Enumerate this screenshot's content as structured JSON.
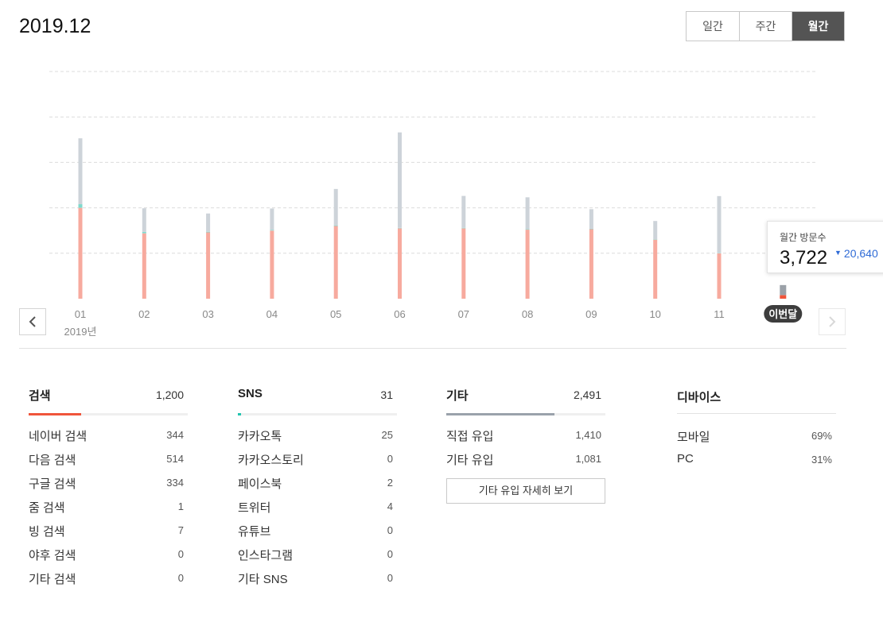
{
  "header": {
    "period": "2019.12"
  },
  "period_tabs": [
    {
      "label": "일간",
      "active": false
    },
    {
      "label": "주간",
      "active": false
    },
    {
      "label": "월간",
      "active": true
    }
  ],
  "chart_data": {
    "type": "bar",
    "stacked": true,
    "categories": [
      "01",
      "02",
      "03",
      "04",
      "05",
      "06",
      "07",
      "08",
      "09",
      "10",
      "11",
      "이번달"
    ],
    "year_label": "2019년",
    "series": [
      {
        "color": "#f7aa9e",
        "values": [
          20000,
          14400,
          14600,
          15000,
          16000,
          15500,
          15500,
          15200,
          15300,
          13000,
          10000,
          780
        ]
      },
      {
        "color": "#7fd9cc",
        "values": [
          800,
          300,
          150,
          150,
          150,
          100,
          120,
          120,
          100,
          100,
          80,
          20
        ]
      },
      {
        "color": "#cdd3d9",
        "values": [
          14500,
          5200,
          4000,
          4700,
          8000,
          21000,
          7000,
          7000,
          4300,
          4000,
          12500,
          2200
        ]
      }
    ],
    "current_colors": [
      "#f0553b",
      "#b8b8b8",
      "#9ba1a8"
    ],
    "ylim": [
      0,
      50000
    ],
    "grid": true
  },
  "tooltip": {
    "label": "월간 방문수",
    "value": "3,722",
    "delta": "20,640",
    "delta_color": "#2f6bd6"
  },
  "panels": {
    "search": {
      "title": "검색",
      "total": "1,200",
      "bar_color": "#f0553b",
      "bar_fraction": 0.33,
      "rows": [
        {
          "label": "네이버 검색",
          "value": "344"
        },
        {
          "label": "다음 검색",
          "value": "514"
        },
        {
          "label": "구글 검색",
          "value": "334"
        },
        {
          "label": "줌 검색",
          "value": "1"
        },
        {
          "label": "빙 검색",
          "value": "7"
        },
        {
          "label": "야후 검색",
          "value": "0"
        },
        {
          "label": "기타 검색",
          "value": "0"
        }
      ]
    },
    "sns": {
      "title": "SNS",
      "total": "31",
      "bar_color": "#22c4b0",
      "bar_fraction": 0.02,
      "rows": [
        {
          "label": "카카오톡",
          "value": "25"
        },
        {
          "label": "카카오스토리",
          "value": "0"
        },
        {
          "label": "페이스북",
          "value": "2"
        },
        {
          "label": "트위터",
          "value": "4"
        },
        {
          "label": "유튜브",
          "value": "0"
        },
        {
          "label": "인스타그램",
          "value": "0"
        },
        {
          "label": "기타 SNS",
          "value": "0"
        }
      ]
    },
    "other": {
      "title": "기타",
      "total": "2,491",
      "bar_color": "#9aa2ab",
      "bar_fraction": 0.68,
      "rows": [
        {
          "label": "직접 유입",
          "value": "1,410"
        },
        {
          "label": "기타 유입",
          "value": "1,081"
        }
      ],
      "detail_button": "기타 유입 자세히 보기"
    },
    "device": {
      "title": "디바이스",
      "rows": [
        {
          "label": "모바일",
          "value": "69%"
        },
        {
          "label": "PC",
          "value": "31%"
        }
      ]
    }
  }
}
